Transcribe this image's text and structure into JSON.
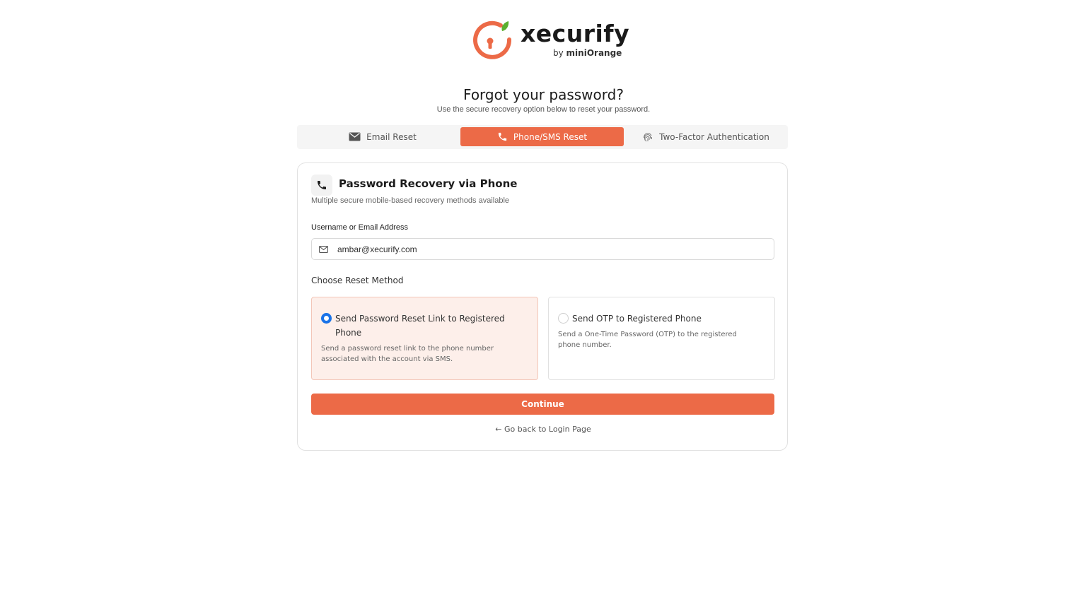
{
  "brand": {
    "name": "xecurify",
    "by_prefix": "by",
    "by_name": "miniOrange",
    "accent_color": "#ec6a47",
    "leaf_color": "#5bb030"
  },
  "header": {
    "title": "Forgot your password?",
    "subtitle": "Use the secure recovery option below to reset your password."
  },
  "tabs": [
    {
      "label": "Email Reset",
      "icon": "envelope-icon",
      "active": false
    },
    {
      "label": "Phone/SMS Reset",
      "icon": "phone-icon",
      "active": true
    },
    {
      "label": "Two-Factor Authentication",
      "icon": "fingerprint-icon",
      "active": false
    }
  ],
  "card": {
    "icon": "phone-icon",
    "title": "Password Recovery via Phone",
    "subtitle": "Multiple secure mobile-based recovery methods available",
    "field_label": "Username or Email Address",
    "field_value": "ambar@xecurify.com",
    "field_icon": "mail-icon",
    "method_label": "Choose Reset Method",
    "options": [
      {
        "title": "Send Password Reset Link to Registered Phone",
        "description": "Send a password reset link to the phone number associated with the account via SMS.",
        "selected": true
      },
      {
        "title": "Send OTP to Registered Phone",
        "description": "Send a One-Time Password (OTP) to the registered phone number.",
        "selected": false
      }
    ],
    "continue_label": "Continue",
    "back_label": "← Go back to Login Page"
  }
}
